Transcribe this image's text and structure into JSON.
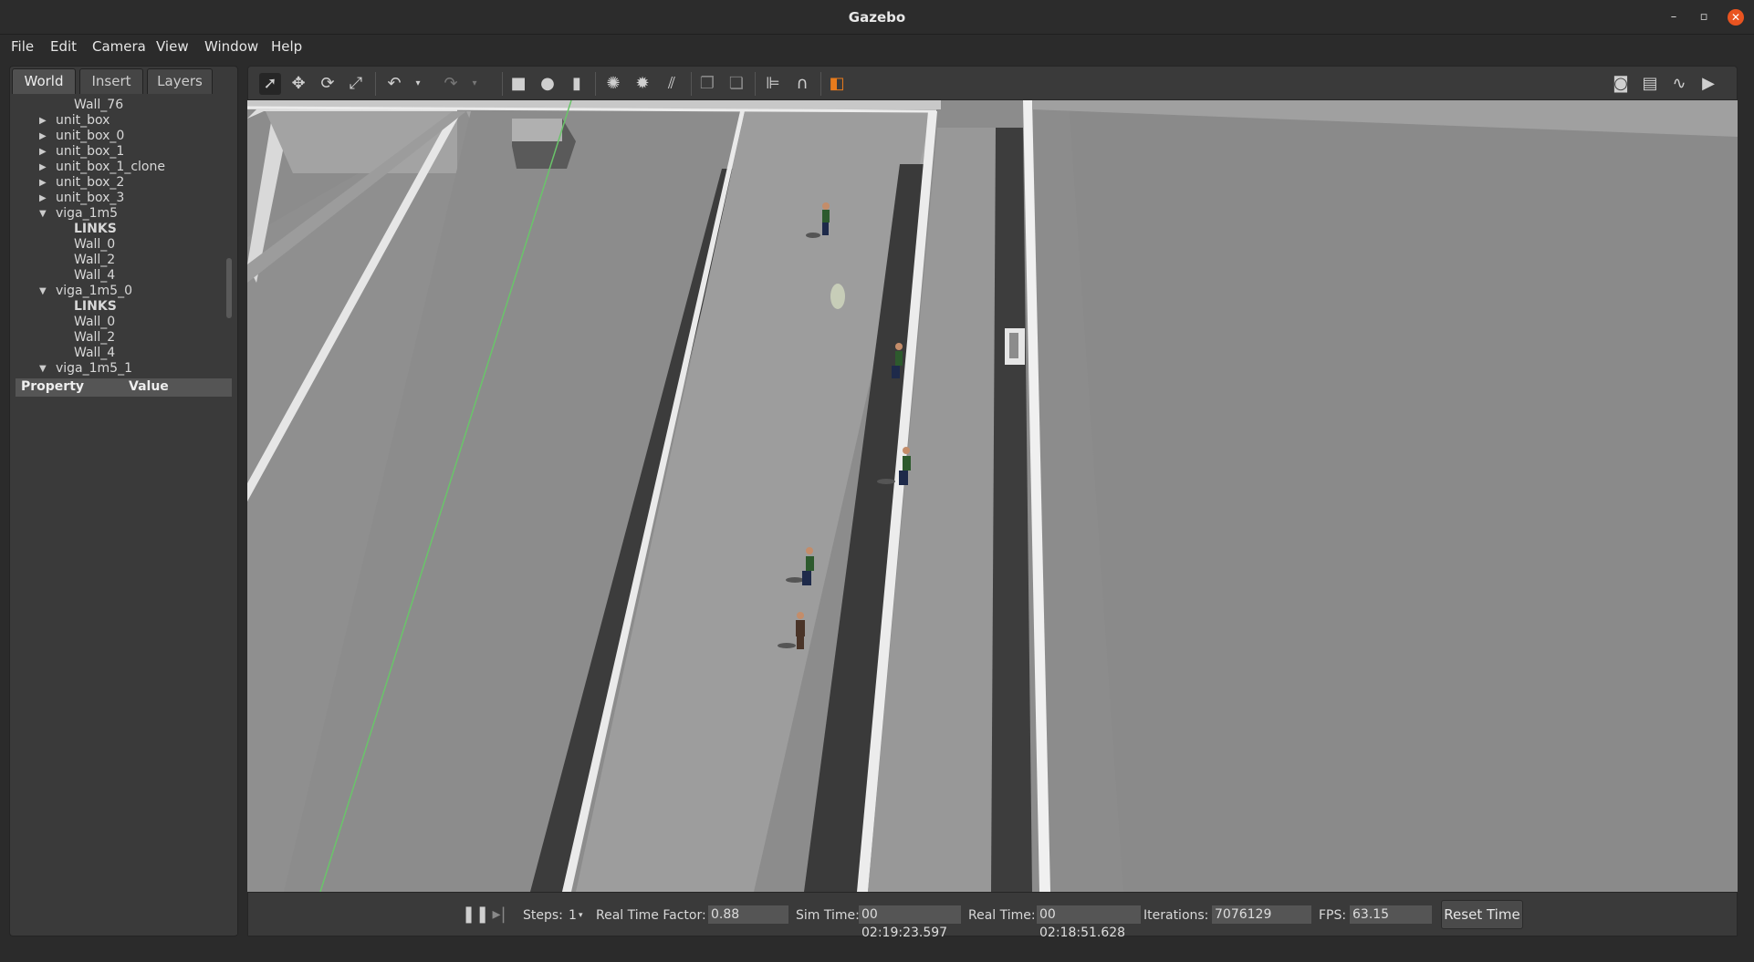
{
  "window": {
    "title": "Gazebo"
  },
  "menu": [
    "File",
    "Edit",
    "Camera",
    "View",
    "Window",
    "Help"
  ],
  "left_panel": {
    "tabs": [
      "World",
      "Insert",
      "Layers"
    ],
    "active_tab": "World",
    "tree": [
      {
        "label": "Wall_76",
        "depth": 2,
        "arrow": ""
      },
      {
        "label": "unit_box",
        "depth": 1,
        "arrow": "right"
      },
      {
        "label": "unit_box_0",
        "depth": 1,
        "arrow": "right"
      },
      {
        "label": "unit_box_1",
        "depth": 1,
        "arrow": "right"
      },
      {
        "label": "unit_box_1_clone",
        "depth": 1,
        "arrow": "right"
      },
      {
        "label": "unit_box_2",
        "depth": 1,
        "arrow": "right"
      },
      {
        "label": "unit_box_3",
        "depth": 1,
        "arrow": "right"
      },
      {
        "label": "viga_1m5",
        "depth": 1,
        "arrow": "down"
      },
      {
        "label": "LINKS",
        "depth": 2,
        "arrow": "",
        "bold": true
      },
      {
        "label": "Wall_0",
        "depth": 2,
        "arrow": ""
      },
      {
        "label": "Wall_2",
        "depth": 2,
        "arrow": ""
      },
      {
        "label": "Wall_4",
        "depth": 2,
        "arrow": ""
      },
      {
        "label": "viga_1m5_0",
        "depth": 1,
        "arrow": "down"
      },
      {
        "label": "LINKS",
        "depth": 2,
        "arrow": "",
        "bold": true
      },
      {
        "label": "Wall_0",
        "depth": 2,
        "arrow": ""
      },
      {
        "label": "Wall_2",
        "depth": 2,
        "arrow": ""
      },
      {
        "label": "Wall_4",
        "depth": 2,
        "arrow": ""
      },
      {
        "label": "viga_1m5_1",
        "depth": 1,
        "arrow": "down"
      }
    ],
    "property_header": {
      "property": "Property",
      "value": "Value"
    }
  },
  "toolbar": {
    "left_tools": [
      "select-mode",
      "translate-mode",
      "rotate-mode",
      "scale-mode",
      "undo",
      "undo-dropdown",
      "redo",
      "redo-dropdown",
      "box-shape",
      "sphere-shape",
      "cylinder-shape",
      "point-light",
      "spot-light",
      "directional-light",
      "copy",
      "paste",
      "align",
      "snap",
      "view-angle"
    ],
    "right_tools": [
      "screenshot",
      "log",
      "plot",
      "record-video"
    ]
  },
  "status": {
    "steps_label": "Steps:",
    "steps_value": "1",
    "rtf_label": "Real Time Factor:",
    "rtf_value": "0.88",
    "sim_time_label": "Sim Time:",
    "sim_time_value": "00 02:19:23.597",
    "real_time_label": "Real Time:",
    "real_time_value": "00 02:18:51.628",
    "iterations_label": "Iterations:",
    "iterations_value": "7076129",
    "fps_label": "FPS:",
    "fps_value": "63.15",
    "reset_label": "Reset Time"
  },
  "colors": {
    "accent": "#e95420",
    "panel": "#3a3a3a",
    "viewport": "#8d8d8d"
  }
}
